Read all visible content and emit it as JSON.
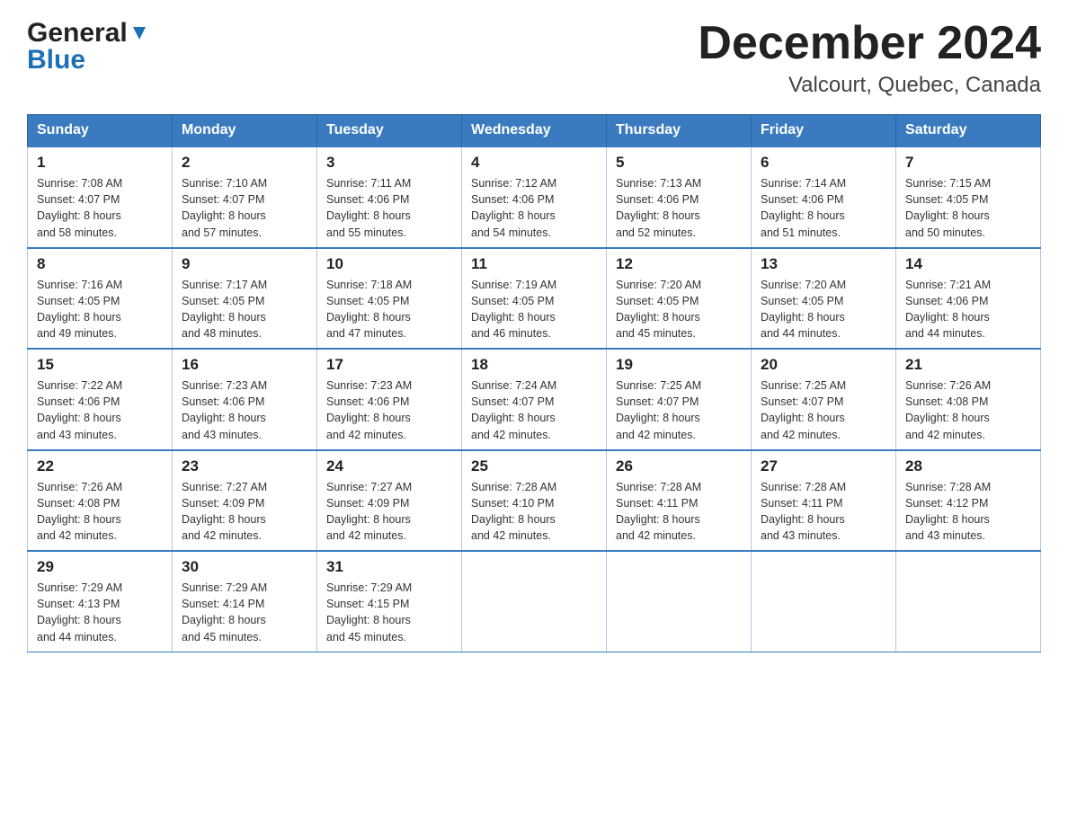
{
  "logo": {
    "general": "General",
    "blue": "Blue"
  },
  "title": "December 2024",
  "subtitle": "Valcourt, Quebec, Canada",
  "weekdays": [
    "Sunday",
    "Monday",
    "Tuesday",
    "Wednesday",
    "Thursday",
    "Friday",
    "Saturday"
  ],
  "weeks": [
    [
      {
        "day": "1",
        "sunrise": "7:08 AM",
        "sunset": "4:07 PM",
        "daylight": "8 hours and 58 minutes."
      },
      {
        "day": "2",
        "sunrise": "7:10 AM",
        "sunset": "4:07 PM",
        "daylight": "8 hours and 57 minutes."
      },
      {
        "day": "3",
        "sunrise": "7:11 AM",
        "sunset": "4:06 PM",
        "daylight": "8 hours and 55 minutes."
      },
      {
        "day": "4",
        "sunrise": "7:12 AM",
        "sunset": "4:06 PM",
        "daylight": "8 hours and 54 minutes."
      },
      {
        "day": "5",
        "sunrise": "7:13 AM",
        "sunset": "4:06 PM",
        "daylight": "8 hours and 52 minutes."
      },
      {
        "day": "6",
        "sunrise": "7:14 AM",
        "sunset": "4:06 PM",
        "daylight": "8 hours and 51 minutes."
      },
      {
        "day": "7",
        "sunrise": "7:15 AM",
        "sunset": "4:05 PM",
        "daylight": "8 hours and 50 minutes."
      }
    ],
    [
      {
        "day": "8",
        "sunrise": "7:16 AM",
        "sunset": "4:05 PM",
        "daylight": "8 hours and 49 minutes."
      },
      {
        "day": "9",
        "sunrise": "7:17 AM",
        "sunset": "4:05 PM",
        "daylight": "8 hours and 48 minutes."
      },
      {
        "day": "10",
        "sunrise": "7:18 AM",
        "sunset": "4:05 PM",
        "daylight": "8 hours and 47 minutes."
      },
      {
        "day": "11",
        "sunrise": "7:19 AM",
        "sunset": "4:05 PM",
        "daylight": "8 hours and 46 minutes."
      },
      {
        "day": "12",
        "sunrise": "7:20 AM",
        "sunset": "4:05 PM",
        "daylight": "8 hours and 45 minutes."
      },
      {
        "day": "13",
        "sunrise": "7:20 AM",
        "sunset": "4:05 PM",
        "daylight": "8 hours and 44 minutes."
      },
      {
        "day": "14",
        "sunrise": "7:21 AM",
        "sunset": "4:06 PM",
        "daylight": "8 hours and 44 minutes."
      }
    ],
    [
      {
        "day": "15",
        "sunrise": "7:22 AM",
        "sunset": "4:06 PM",
        "daylight": "8 hours and 43 minutes."
      },
      {
        "day": "16",
        "sunrise": "7:23 AM",
        "sunset": "4:06 PM",
        "daylight": "8 hours and 43 minutes."
      },
      {
        "day": "17",
        "sunrise": "7:23 AM",
        "sunset": "4:06 PM",
        "daylight": "8 hours and 42 minutes."
      },
      {
        "day": "18",
        "sunrise": "7:24 AM",
        "sunset": "4:07 PM",
        "daylight": "8 hours and 42 minutes."
      },
      {
        "day": "19",
        "sunrise": "7:25 AM",
        "sunset": "4:07 PM",
        "daylight": "8 hours and 42 minutes."
      },
      {
        "day": "20",
        "sunrise": "7:25 AM",
        "sunset": "4:07 PM",
        "daylight": "8 hours and 42 minutes."
      },
      {
        "day": "21",
        "sunrise": "7:26 AM",
        "sunset": "4:08 PM",
        "daylight": "8 hours and 42 minutes."
      }
    ],
    [
      {
        "day": "22",
        "sunrise": "7:26 AM",
        "sunset": "4:08 PM",
        "daylight": "8 hours and 42 minutes."
      },
      {
        "day": "23",
        "sunrise": "7:27 AM",
        "sunset": "4:09 PM",
        "daylight": "8 hours and 42 minutes."
      },
      {
        "day": "24",
        "sunrise": "7:27 AM",
        "sunset": "4:09 PM",
        "daylight": "8 hours and 42 minutes."
      },
      {
        "day": "25",
        "sunrise": "7:28 AM",
        "sunset": "4:10 PM",
        "daylight": "8 hours and 42 minutes."
      },
      {
        "day": "26",
        "sunrise": "7:28 AM",
        "sunset": "4:11 PM",
        "daylight": "8 hours and 42 minutes."
      },
      {
        "day": "27",
        "sunrise": "7:28 AM",
        "sunset": "4:11 PM",
        "daylight": "8 hours and 43 minutes."
      },
      {
        "day": "28",
        "sunrise": "7:28 AM",
        "sunset": "4:12 PM",
        "daylight": "8 hours and 43 minutes."
      }
    ],
    [
      {
        "day": "29",
        "sunrise": "7:29 AM",
        "sunset": "4:13 PM",
        "daylight": "8 hours and 44 minutes."
      },
      {
        "day": "30",
        "sunrise": "7:29 AM",
        "sunset": "4:14 PM",
        "daylight": "8 hours and 45 minutes."
      },
      {
        "day": "31",
        "sunrise": "7:29 AM",
        "sunset": "4:15 PM",
        "daylight": "8 hours and 45 minutes."
      },
      null,
      null,
      null,
      null
    ]
  ],
  "labels": {
    "sunrise": "Sunrise: ",
    "sunset": "Sunset: ",
    "daylight": "Daylight: "
  }
}
